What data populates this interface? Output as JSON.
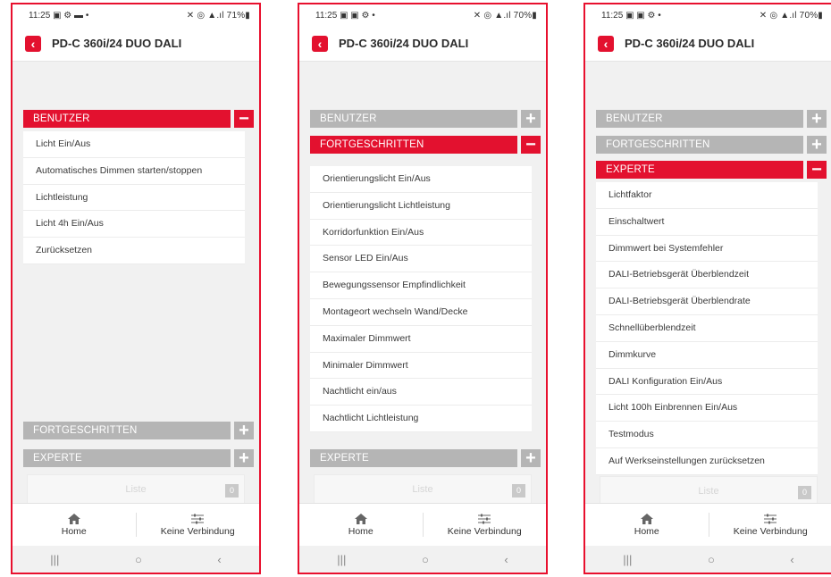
{
  "phones": [
    {
      "status": {
        "time": "11:25",
        "left_icons": "▣ ⚙ ▬ •",
        "right": "✕ ◎ ▲.ıl 71%▮"
      },
      "title": "PD-C 360i/24 DUO DALI",
      "sections": [
        {
          "label": "BENUTZER",
          "toggle": "−",
          "state": "open"
        },
        {
          "label": "FORTGESCHRITTEN",
          "toggle": "+",
          "state": "closed"
        },
        {
          "label": "EXPERTE",
          "toggle": "+",
          "state": "closed"
        }
      ],
      "items": [
        "Licht Ein/Aus",
        "Automatisches Dimmen starten/stoppen",
        "Lichtleistung",
        "Licht 4h Ein/Aus",
        "Zurücksetzen"
      ],
      "liste": {
        "label": "Liste",
        "count": "0"
      },
      "nav": {
        "home": "Home",
        "connection": "Keine Verbindung"
      },
      "sysbar": {
        "recent": "|||",
        "home": "○",
        "back": "‹"
      }
    },
    {
      "status": {
        "time": "11:25",
        "left_icons": "▣ ▣ ⚙ •",
        "right": "✕ ◎ ▲.ıl 70%▮"
      },
      "title": "PD-C 360i/24 DUO DALI",
      "sections": [
        {
          "label": "BENUTZER",
          "toggle": "+",
          "state": "closed"
        },
        {
          "label": "FORTGESCHRITTEN",
          "toggle": "−",
          "state": "open"
        },
        {
          "label": "EXPERTE",
          "toggle": "+",
          "state": "closed"
        }
      ],
      "items": [
        "Orientierungslicht Ein/Aus",
        "Orientierungslicht Lichtleistung",
        "Korridorfunktion Ein/Aus",
        "Sensor LED Ein/Aus",
        "Bewegungssensor Empfindlichkeit",
        "Montageort wechseln Wand/Decke",
        "Maximaler Dimmwert",
        "Minimaler Dimmwert",
        "Nachtlicht ein/aus",
        "Nachtlicht Lichtleistung"
      ],
      "liste": {
        "label": "Liste",
        "count": "0"
      },
      "nav": {
        "home": "Home",
        "connection": "Keine Verbindung"
      },
      "sysbar": {
        "recent": "|||",
        "home": "○",
        "back": "‹"
      }
    },
    {
      "status": {
        "time": "11:25",
        "left_icons": "▣ ▣ ⚙ •",
        "right": "✕ ◎ ▲.ıl 70%▮"
      },
      "title": "PD-C 360i/24 DUO DALI",
      "sections": [
        {
          "label": "BENUTZER",
          "toggle": "+",
          "state": "closed"
        },
        {
          "label": "FORTGESCHRITTEN",
          "toggle": "+",
          "state": "closed"
        },
        {
          "label": "EXPERTE",
          "toggle": "−",
          "state": "open"
        }
      ],
      "items": [
        "Lichtfaktor",
        "Einschaltwert",
        "Dimmwert bei Systemfehler",
        "DALI-Betriebsgerät Überblendzeit",
        "DALI-Betriebsgerät Überblendrate",
        "Schnellüberblendzeit",
        "Dimmkurve",
        "DALI Konfiguration Ein/Aus",
        "Licht 100h Einbrennen Ein/Aus",
        "Testmodus",
        "Auf Werkseinstellungen zurücksetzen"
      ],
      "liste": {
        "label": "Liste",
        "count": "0"
      },
      "nav": {
        "home": "Home",
        "connection": "Keine Verbindung"
      },
      "sysbar": {
        "recent": "|||",
        "home": "○",
        "back": "‹"
      }
    }
  ],
  "colors": {
    "accent": "#e3112f",
    "collapsed": "#b5b5b5",
    "frame": "#e8102e"
  }
}
